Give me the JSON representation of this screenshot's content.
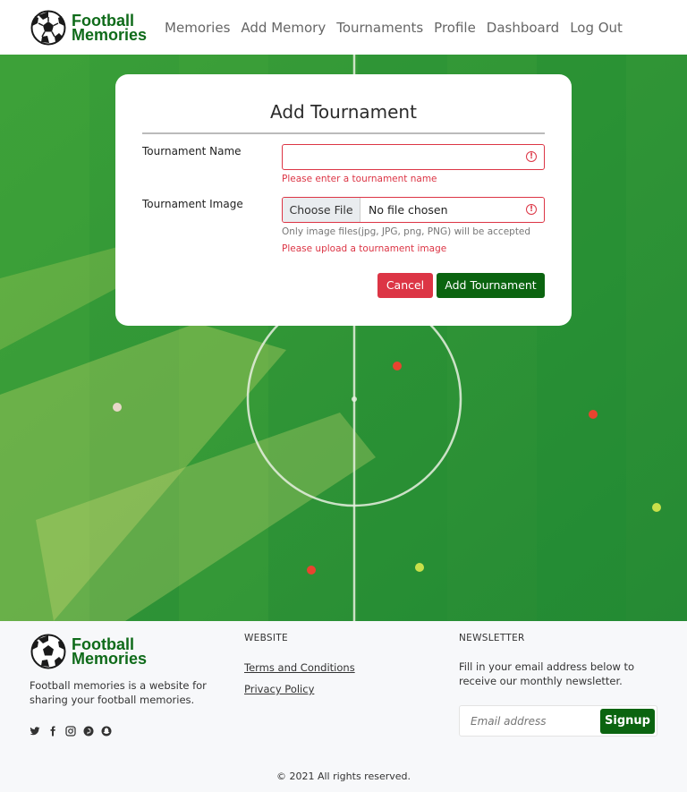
{
  "brand": {
    "line1": "Football",
    "line2": "Memories"
  },
  "nav": [
    {
      "label": "Memories"
    },
    {
      "label": "Add Memory"
    },
    {
      "label": "Tournaments"
    },
    {
      "label": "Profile"
    },
    {
      "label": "Dashboard"
    },
    {
      "label": "Log Out"
    }
  ],
  "form": {
    "title": "Add Tournament",
    "name_label": "Tournament Name",
    "name_value": "",
    "name_error": "Please enter a tournament name",
    "image_label": "Tournament Image",
    "choose_file_label": "Choose File",
    "file_status": "No file chosen",
    "image_hint": "Only image files(jpg, JPG, png, PNG) will be accepted",
    "image_error": "Please upload a tournament image",
    "cancel_label": "Cancel",
    "submit_label": "Add Tournament",
    "error_color": "#dc3545",
    "primary_color": "#0b6410"
  },
  "footer": {
    "description": "Football memories is a website for sharing your football memories.",
    "website_heading": "WEBSITE",
    "links": [
      {
        "label": "Terms and Conditions"
      },
      {
        "label": "Privacy Policy"
      }
    ],
    "newsletter_heading": "NEWSLETTER",
    "newsletter_text": "Fill in your email address below to receive our monthly newsletter.",
    "email_placeholder": "Email address",
    "signup_label": "Signup",
    "socials": [
      "twitter-icon",
      "facebook-icon",
      "instagram-icon",
      "pinterest-icon",
      "snapchat-icon"
    ],
    "copyright": "© 2021 All rights reserved."
  }
}
